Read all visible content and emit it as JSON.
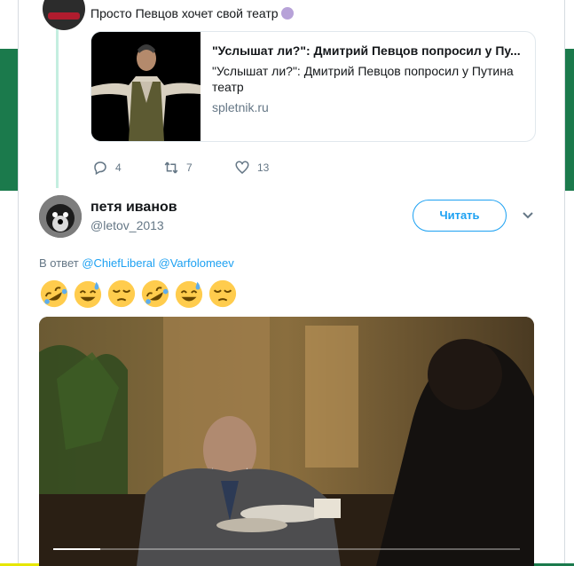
{
  "previous_tweet": {
    "text": "Просто Певцов хочет свой театр",
    "emoji": "performing-arts-emoji",
    "card": {
      "title": "\"Услышат ли?\": Дмитрий Певцов попросил у Пу...",
      "description": "\"Услышат ли?\": Дмитрий Певцов попросил у Путина театр",
      "domain": "spletnik.ru"
    },
    "actions": {
      "replies": "4",
      "retweets": "7",
      "likes": "13"
    }
  },
  "tweet": {
    "author": {
      "name": "петя иванов",
      "handle": "@letov_2013"
    },
    "follow_label": "Читать",
    "reply_prefix": "В ответ",
    "reply_mentions": [
      "@ChiefLiberal",
      "@Varfolomeev"
    ],
    "emojis": [
      "rofl",
      "sweat-smile",
      "pensive",
      "rofl",
      "sweat-smile",
      "pensive"
    ],
    "video": {
      "progress": 0.1
    }
  },
  "colors": {
    "accent": "#1da1f2",
    "thread_line": "#c4eee0",
    "muted_text": "#657786",
    "side_band": "#1b7a4c"
  }
}
